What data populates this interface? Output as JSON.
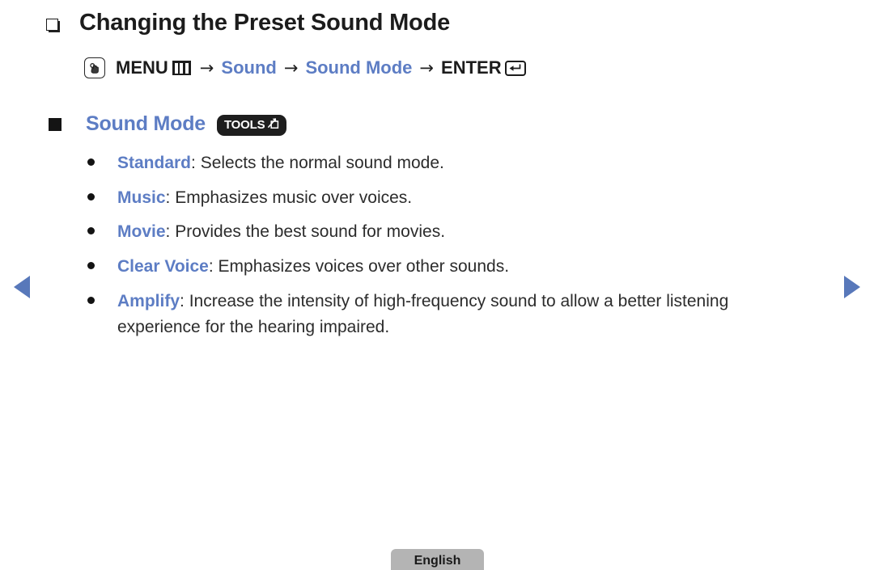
{
  "document": {
    "title": "Changing the Preset Sound Mode",
    "title_bullet_icon": "hollow-square-bullet-icon"
  },
  "menu_path": {
    "hand_icon": "hand-press-icon",
    "menu_label": "MENU",
    "menu_icon": "menu-bars-icon",
    "arrow": "→",
    "step_sound": "Sound",
    "step_sound_mode": "Sound Mode",
    "enter_label": "ENTER",
    "enter_icon": "enter-return-icon"
  },
  "section": {
    "bullet_icon": "filled-square-bullet-icon",
    "title": "Sound Mode",
    "badge_label": "TOOLS",
    "badge_icon": "tools-arrow-box-icon"
  },
  "options": [
    {
      "keyword": "Standard",
      "separator": ": ",
      "description": "Selects the normal sound mode."
    },
    {
      "keyword": "Music",
      "separator": ": ",
      "description": "Emphasizes music over voices."
    },
    {
      "keyword": "Movie",
      "separator": ": ",
      "description": "Provides the best sound for movies."
    },
    {
      "keyword": "Clear Voice",
      "separator": ": ",
      "description": "Emphasizes voices over other sounds."
    },
    {
      "keyword": "Amplify",
      "separator": ": ",
      "description": "Increase the intensity of high-frequency sound to allow a better listening experience for the hearing impaired."
    }
  ],
  "navigation": {
    "previous_icon": "arrow-left-icon",
    "next_icon": "arrow-right-icon"
  },
  "footer": {
    "language": "English"
  },
  "colors": {
    "accent_blue": "#5d7dc4",
    "nav_arrow_blue": "#5878ba",
    "body_text": "#2c2c2c",
    "badge_dark": "#1e1e1e",
    "footer_tab_gray": "#b4b4b4",
    "background": "#ffffff"
  }
}
